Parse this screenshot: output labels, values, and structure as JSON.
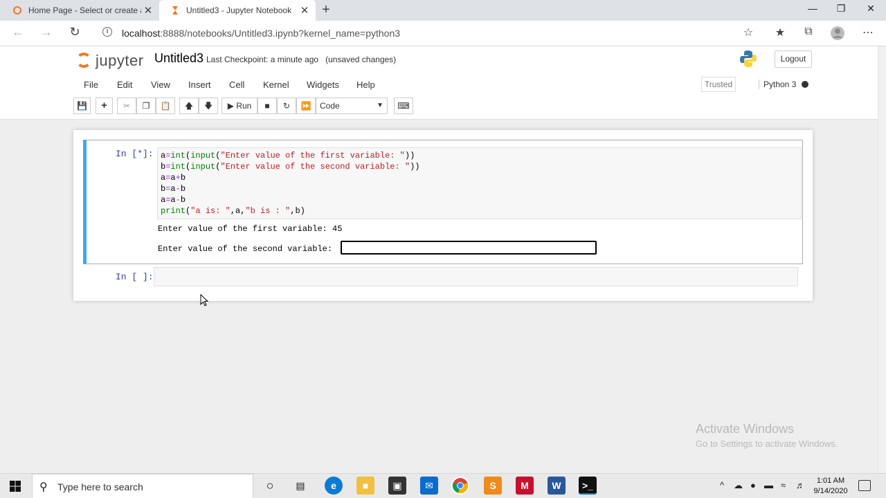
{
  "browser": {
    "tabs": [
      {
        "title": "Home Page - Select or create a n",
        "active": false
      },
      {
        "title": "Untitled3 - Jupyter Notebook",
        "active": true
      }
    ],
    "close_glyph": "✕",
    "new_tab_glyph": "+",
    "url_host": "localhost",
    "url_rest": ":8888/notebooks/Untitled3.ipynb?kernel_name=python3",
    "info_glyph": "i"
  },
  "jupyter": {
    "logo_text": "jupyter",
    "notebook_name": "Untitled3",
    "checkpoint": "Last Checkpoint: a minute ago",
    "unsaved": "(unsaved changes)",
    "logout": "Logout",
    "menu": [
      "File",
      "Edit",
      "View",
      "Insert",
      "Cell",
      "Kernel",
      "Widgets",
      "Help"
    ],
    "trusted": "Trusted",
    "kernel_name": "Python 3",
    "run_label": "Run",
    "cell_type": "Code"
  },
  "cells": {
    "cell1": {
      "prompt": "In [*]:",
      "code_lines": [
        "a=int(input(\"Enter value of the first variable: \"))",
        "b=int(input(\"Enter value of the second variable: \"))",
        "a=a+b",
        "b=a-b",
        "a=a-b",
        "print(\"a is: \",a,\"b is : \",b)"
      ],
      "output_1": "Enter value of the first variable: 45",
      "output_2": "Enter value of the second variable: "
    },
    "cell2": {
      "prompt": "In [ ]:"
    }
  },
  "watermark": {
    "line1": "Activate Windows",
    "line2": "Go to Settings to activate Windows."
  },
  "taskbar": {
    "search_placeholder": "Type here to search",
    "time": "1:01 AM",
    "date": "9/14/2020"
  }
}
